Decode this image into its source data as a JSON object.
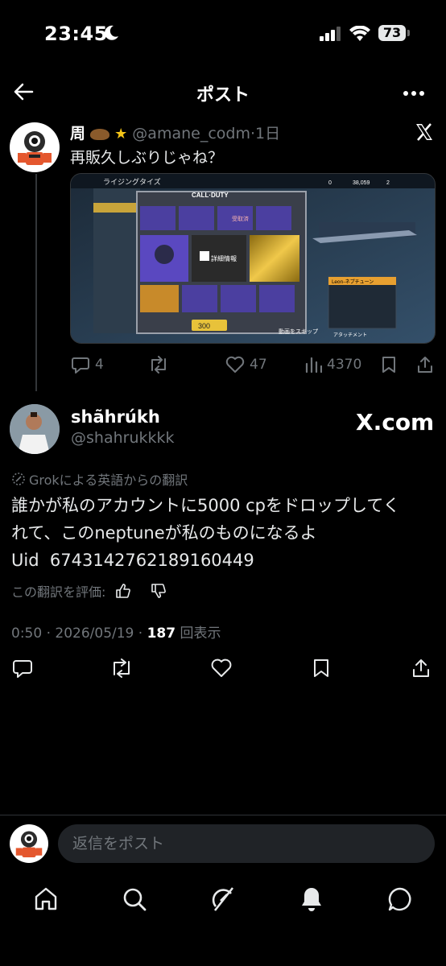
{
  "status_bar": {
    "time": "23:45",
    "battery": "73"
  },
  "header": {
    "title": "ポスト"
  },
  "tweet": {
    "name": "周",
    "handle": "@amane_codm",
    "time": "1日",
    "text": "再販久しぶりじゃね？",
    "media": {
      "top_label": "ライジングタイズ",
      "logo": "CALL·DUTY",
      "detail": "詳細情報",
      "claimed": "受取済",
      "price": "300",
      "skip": "動画をスキップ",
      "attachment": "アタッチメント",
      "weapon_name": "Leon-ネプチューン",
      "currency1": "0",
      "currency2": "38,059",
      "currency3": "2"
    },
    "replies": "4",
    "likes": "47",
    "views": "4370"
  },
  "quote": {
    "name": "shãhrúkh",
    "handle": "@shahrukkkk",
    "site": "X.com",
    "grok_note": "Grokによる英語からの翻訳",
    "text_line1": "誰かが私のアカウントに5000 cpをドロップしてく",
    "text_line2": "れて、このneptuneが私のものになるよ",
    "text_line3": "Uid  6743142762189160449",
    "rate_label": "この翻訳を評価:",
    "time": "0:50 · 2026/05/19 · ",
    "views_count": "187",
    "views_label": "回表示"
  },
  "reply": {
    "placeholder": "返信をポスト"
  },
  "icons": [
    "back-arrow-icon",
    "more-icon",
    "x-logo-icon",
    "reply-icon",
    "repost-icon",
    "like-icon",
    "views-icon",
    "bookmark-icon",
    "share-icon",
    "grok-icon",
    "thumbs-up-icon",
    "thumbs-down-icon",
    "home-icon",
    "search-icon",
    "grok-nav-icon",
    "notifications-icon",
    "messages-icon"
  ],
  "colors": {
    "background": "#000000",
    "text": "#e7e9ea",
    "muted": "#71767b",
    "divider": "#2f3336"
  }
}
